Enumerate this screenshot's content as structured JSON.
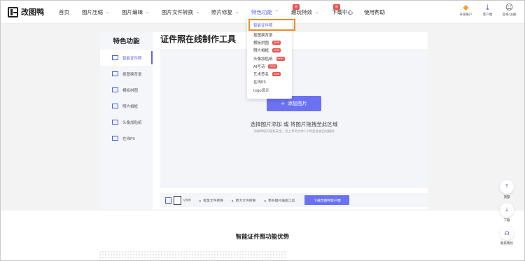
{
  "logo": {
    "text": "改图鸭"
  },
  "nav": [
    {
      "label": "首页",
      "chevron": false
    },
    {
      "label": "图片压缩",
      "chevron": true
    },
    {
      "label": "图片编辑",
      "chevron": true
    },
    {
      "label": "图片文件转换",
      "chevron": true
    },
    {
      "label": "照片修复",
      "chevron": true
    },
    {
      "label": "特色功能",
      "chevron": true,
      "active": true,
      "badge": "热"
    },
    {
      "label": "趣玩特效",
      "chevron": true,
      "badge": "热"
    },
    {
      "label": "下载中心",
      "chevron": false
    },
    {
      "label": "使用帮助",
      "chevron": false
    }
  ],
  "right_actions": [
    {
      "label": "升级账户",
      "icon": "diamond-icon"
    },
    {
      "label": "客户端",
      "icon": "download-icon"
    },
    {
      "label": "登录/注册",
      "icon": "user-icon"
    }
  ],
  "dropdown": [
    {
      "label": "智能证件照",
      "highlight": true
    },
    {
      "label": "抠图换背景"
    },
    {
      "label": "横板拼图",
      "new": "NEW"
    },
    {
      "label": "照片相框",
      "new": "NEW"
    },
    {
      "label": "头像加贴纸",
      "new": "NEW"
    },
    {
      "label": "AI写诗",
      "new": "NEW"
    },
    {
      "label": "艺术签名",
      "new": "NEW"
    },
    {
      "label": "在线PS"
    },
    {
      "label": "logo设计"
    }
  ],
  "sidebar": {
    "title": "特色功能",
    "items": [
      {
        "label": "智能证件照",
        "active": true
      },
      {
        "label": "抠图换背景"
      },
      {
        "label": "横板拼图"
      },
      {
        "label": "照片相框"
      },
      {
        "label": "头像加贴纸"
      },
      {
        "label": "在线PS"
      }
    ]
  },
  "main": {
    "title": "证件照在线制作工具",
    "upload_button": "添加图片",
    "upload_hint": "选择图片添加 或 将图片拖拽至此区域",
    "upload_sub": "为保障您的隐私安全，您上传的文件1小时后会被自动删除"
  },
  "toolbar": {
    "selected_label": "证件照",
    "links": [
      "批量文件转换",
      "更大文件转换",
      "更多图片编辑工具"
    ],
    "button": "下载改图鸭客户端"
  },
  "bottom": {
    "title": "智能证件照功能优势"
  },
  "floats": [
    {
      "label": "顶部",
      "icon": "to-top-icon"
    },
    {
      "label": "下载",
      "icon": "download-icon"
    },
    {
      "label": "联系我们",
      "icon": "headset-icon"
    }
  ],
  "colors": {
    "accent": "#5b63f0",
    "badge": "#e9534f",
    "highlight_border": "#f08a24"
  }
}
